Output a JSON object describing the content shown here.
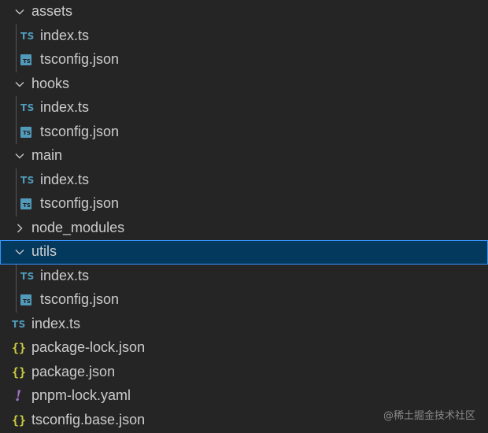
{
  "explorer": {
    "rows": [
      {
        "label": "assets",
        "kind": "folder",
        "expanded": true,
        "level": 1,
        "icon": "chevron-down-icon"
      },
      {
        "label": "index.ts",
        "kind": "file",
        "level": 2,
        "icon": "typescript-icon",
        "icon_text": "TS"
      },
      {
        "label": "tsconfig.json",
        "kind": "file",
        "level": 2,
        "icon": "tsconfig-icon",
        "icon_text": "TS"
      },
      {
        "label": "hooks",
        "kind": "folder",
        "expanded": true,
        "level": 1,
        "icon": "chevron-down-icon"
      },
      {
        "label": "index.ts",
        "kind": "file",
        "level": 2,
        "icon": "typescript-icon",
        "icon_text": "TS"
      },
      {
        "label": "tsconfig.json",
        "kind": "file",
        "level": 2,
        "icon": "tsconfig-icon",
        "icon_text": "TS"
      },
      {
        "label": "main",
        "kind": "folder",
        "expanded": true,
        "level": 1,
        "icon": "chevron-down-icon"
      },
      {
        "label": "index.ts",
        "kind": "file",
        "level": 2,
        "icon": "typescript-icon",
        "icon_text": "TS"
      },
      {
        "label": "tsconfig.json",
        "kind": "file",
        "level": 2,
        "icon": "tsconfig-icon",
        "icon_text": "TS"
      },
      {
        "label": "node_modules",
        "kind": "folder",
        "expanded": false,
        "level": 1,
        "icon": "chevron-right-icon"
      },
      {
        "label": "utils",
        "kind": "folder",
        "expanded": true,
        "level": 1,
        "selected": true,
        "icon": "chevron-down-icon"
      },
      {
        "label": "index.ts",
        "kind": "file",
        "level": 2,
        "icon": "typescript-icon",
        "icon_text": "TS"
      },
      {
        "label": "tsconfig.json",
        "kind": "file",
        "level": 2,
        "icon": "tsconfig-icon",
        "icon_text": "TS"
      },
      {
        "label": "index.ts",
        "kind": "file",
        "level": 1,
        "icon": "typescript-icon",
        "icon_text": "TS"
      },
      {
        "label": "package-lock.json",
        "kind": "file",
        "level": 1,
        "icon": "json-braces-icon",
        "icon_text": "{}"
      },
      {
        "label": "package.json",
        "kind": "file",
        "level": 1,
        "icon": "json-braces-icon",
        "icon_text": "{}"
      },
      {
        "label": "pnpm-lock.yaml",
        "kind": "file",
        "level": 1,
        "icon": "yaml-icon",
        "icon_text": "!"
      },
      {
        "label": "tsconfig.base.json",
        "kind": "file",
        "level": 1,
        "icon": "json-braces-icon",
        "icon_text": "{}"
      }
    ]
  },
  "watermark": "@稀土掘金技术社区",
  "colors": {
    "background": "#252526",
    "selection_bg": "#04395e",
    "selection_border": "#3794ff",
    "ts_blue": "#519aba",
    "json_yellow": "#cbcb41",
    "yaml_purple": "#a074c4"
  }
}
